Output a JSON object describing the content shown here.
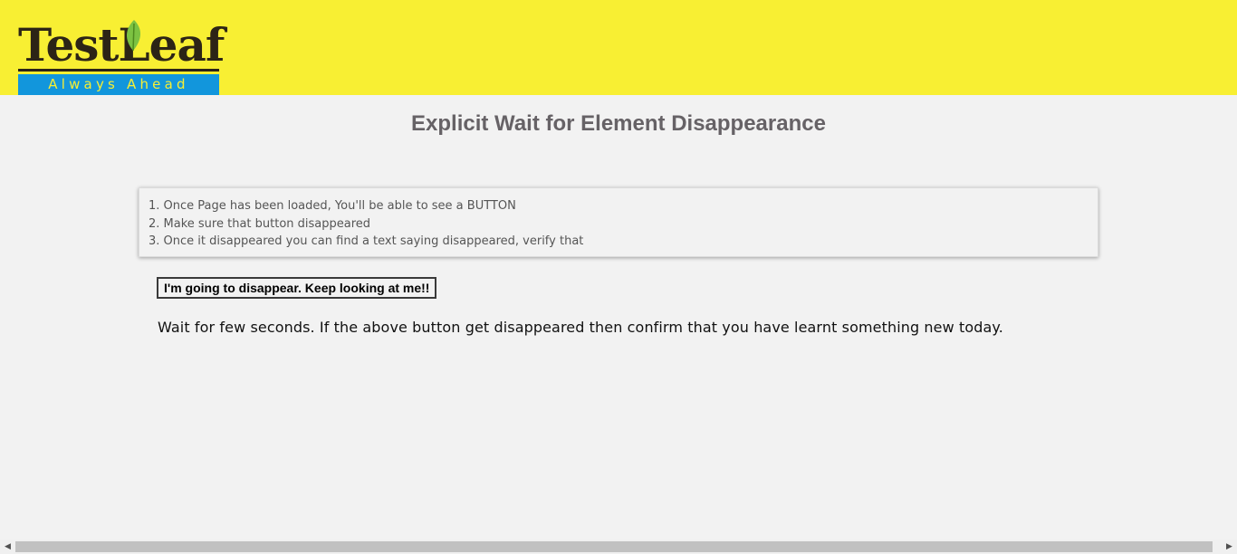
{
  "header": {
    "logo": {
      "word": "TestLeaf",
      "tagline": "Always Ahead",
      "colors": {
        "wordmark": "#2c2416",
        "leaf": "#7cc242",
        "tagline_bg": "#1296dc",
        "tagline_text": "#f8ef33"
      }
    },
    "background": "#f8ef33"
  },
  "main": {
    "title": "Explicit Wait for Element Disappearance",
    "instructions": [
      "1. Once Page has been loaded, You'll be able to see a BUTTON",
      "2. Make sure that button disappeared",
      "3. Once it disappeared you can find a text saying disappeared, verify that"
    ],
    "button_label": "I'm going to disappear. Keep looking at me!!",
    "wait_text": "Wait for few seconds. If the above button get disappeared then confirm that you have learnt something new today."
  },
  "scrollbar": {
    "left_icon": "arrow-left-icon",
    "right_icon": "arrow-right-icon"
  }
}
